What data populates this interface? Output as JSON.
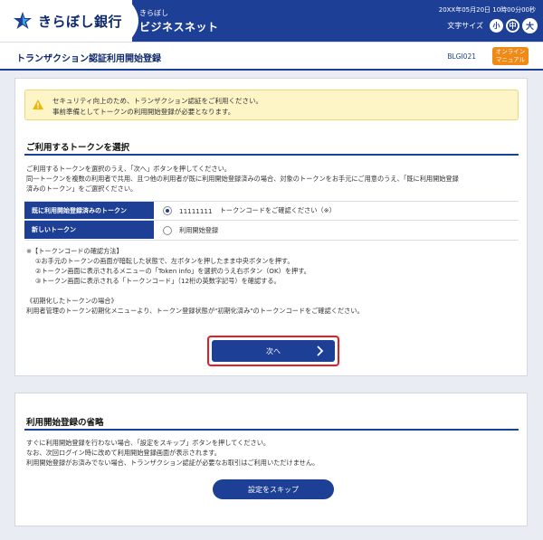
{
  "header": {
    "bank_name": "きらぼし銀行",
    "service_sub": "きらぼし",
    "service_main": "ビジネスネット",
    "datetime": "20XX年05月20日 10時00分00秒",
    "font_size_label": "文字サイズ",
    "font_sizes": [
      "小",
      "中",
      "大"
    ],
    "brand_color": "#1d3f95"
  },
  "titlebar": {
    "title": "トランザクション認証利用開始登録",
    "screen_id": "BLGI021",
    "manual_line1": "オンライン",
    "manual_line2": "マニュアル"
  },
  "notice": {
    "line1": "セキュリティ向上のため、トランザクション認証をご利用ください。",
    "line2": "事前準備としてトークンの利用開始登録が必要となります。"
  },
  "select_token": {
    "title": "ご利用するトークンを選択",
    "desc1": "ご利用するトークンを選択のうえ、「次へ」ボタンを押してください。",
    "desc2": "同一トークンを複数の利用者で共用、且つ他の利用者が既に利用開始登録済みの場合、対象のトークンをお手元にご用意のうえ、「既に利用開始登録",
    "desc3": "済みのトークン」をご選択ください。",
    "rows": [
      {
        "head": "既に利用開始登録済みのトークン",
        "code": "11111111",
        "text": "トークンコードをご確認ください（※）",
        "checked": true
      },
      {
        "head": "新しいトークン",
        "code": "",
        "text": "利用開始登録",
        "checked": false
      }
    ],
    "note_title": "※【トークンコードの確認方法】",
    "note1": "①お手元のトークンの画面が暗転した状態で、左ボタンを押したまま中央ボタンを押す。",
    "note2": "②トークン画面に表示されるメニューの「Token info」を選択のうえ右ボタン（OK）を押す。",
    "note3": "③トークン画面に表示される「トークンコード」（12桁の英数字記号）を確認する。",
    "init_title": "《初期化したトークンの場合》",
    "init_text": "利用者管理のトークン初期化メニューより、トークン登録状態が\"初期化済み\"のトークンコードをご確認ください。",
    "next_label": "次へ"
  },
  "skip": {
    "title": "利用開始登録の省略",
    "desc1": "すぐに利用開始登録を行わない場合、「設定をスキップ」ボタンを押してください。",
    "desc2": "なお、次回ログイン時に改めて利用開始登録画面が表示されます。",
    "desc3": "利用開始登録がお済みでない場合、トランザクション認証が必要なお取引はご利用いただけません。",
    "skip_label": "設定をスキップ"
  }
}
